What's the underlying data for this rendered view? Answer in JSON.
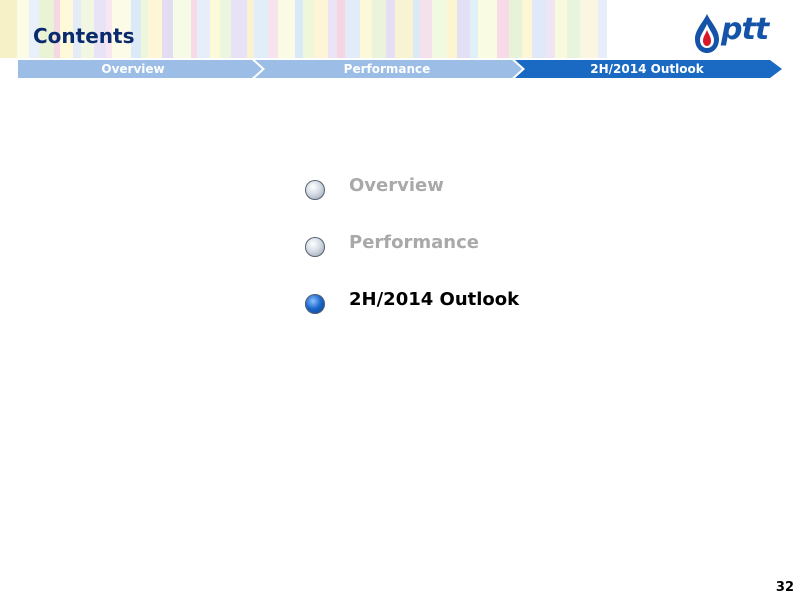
{
  "slide": {
    "title": "Contents",
    "page_number": "32"
  },
  "logo": {
    "text": "ptt"
  },
  "nav": {
    "items": [
      {
        "label": "Overview",
        "active": false
      },
      {
        "label": "Performance",
        "active": false
      },
      {
        "label": "2H/2014 Outlook",
        "active": true
      }
    ]
  },
  "agenda": {
    "items": [
      {
        "label": "Overview",
        "active": false
      },
      {
        "label": "Performance",
        "active": false
      },
      {
        "label": "2H/2014 Outlook",
        "active": true
      }
    ]
  },
  "colors": {
    "title": "#0a2a6e",
    "nav_inactive": "#9bbde6",
    "nav_active": "#1a6ac4",
    "agenda_inactive": "#a9a9a9",
    "agenda_active": "#000000"
  }
}
